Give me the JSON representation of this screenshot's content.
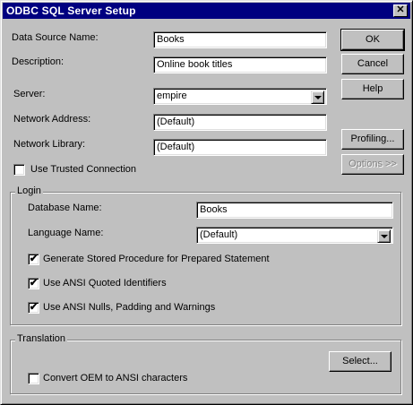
{
  "window": {
    "title": "ODBC SQL Server Setup",
    "close_glyph": "✕"
  },
  "form": {
    "dsn_label": "Data Source Name:",
    "dsn_value": "Books",
    "desc_label": "Description:",
    "desc_value": "Online book titles",
    "server_label": "Server:",
    "server_value": "empire",
    "netaddr_label": "Network Address:",
    "netaddr_value": "(Default)",
    "netlib_label": "Network Library:",
    "netlib_value": "(Default)",
    "trusted_label": "Use Trusted Connection",
    "trusted_checked": false
  },
  "buttons": {
    "ok": "OK",
    "cancel": "Cancel",
    "help": "Help",
    "profiling": "Profiling...",
    "options": "Options >>",
    "select": "Select..."
  },
  "login": {
    "title": "Login",
    "dbname_label": "Database Name:",
    "dbname_value": "Books",
    "lang_label": "Language Name:",
    "lang_value": "(Default)",
    "gen_proc_label": "Generate Stored Procedure for Prepared Statement",
    "gen_proc_checked": true,
    "quoted_label": "Use ANSI Quoted Identifiers",
    "quoted_checked": true,
    "nulls_label": "Use ANSI Nulls, Padding and Warnings",
    "nulls_checked": true
  },
  "translation": {
    "title": "Translation",
    "oem_label": "Convert OEM to ANSI characters",
    "oem_checked": false
  },
  "icons": {
    "check_glyph": "✔",
    "close": "close-icon",
    "dropdown": "chevron-down-icon"
  }
}
